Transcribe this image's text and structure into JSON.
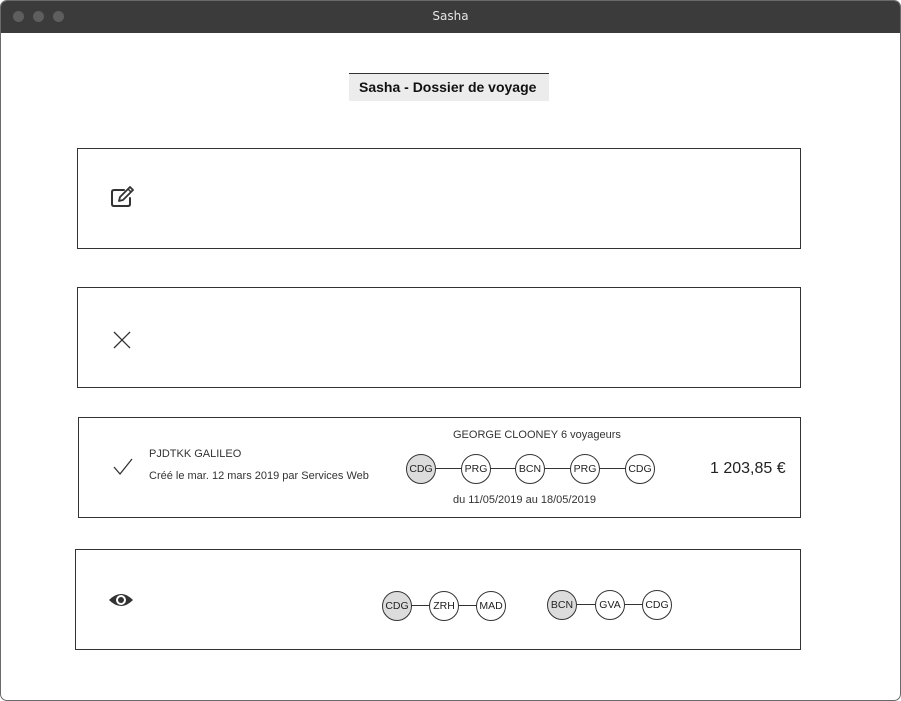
{
  "window": {
    "title": "Sasha"
  },
  "page": {
    "title": "Sasha - Dossier de voyage"
  },
  "cards": {
    "booked": {
      "pnr": "PJDTKK GALILEO",
      "created": "Créé le mar. 12 mars 2019 par Services Web",
      "traveler": "GEORGE CLOONEY 6 voyageurs",
      "dates": "du 11/05/2019 au 18/05/2019",
      "price": "1 203,85 €",
      "route": [
        "CDG",
        "PRG",
        "BCN",
        "PRG",
        "CDG"
      ]
    },
    "preview": {
      "route_a": [
        "CDG",
        "ZRH",
        "MAD"
      ],
      "route_b": [
        "BCN",
        "GVA",
        "CDG"
      ]
    }
  },
  "icons": {
    "card1": "edit-icon",
    "card2": "close-icon",
    "card3": "check-icon",
    "card4": "eye-icon"
  },
  "colors": {
    "titlebar": "#3b3b3b",
    "node_filled": "#dcdcdc",
    "title_bg": "#ececec"
  }
}
